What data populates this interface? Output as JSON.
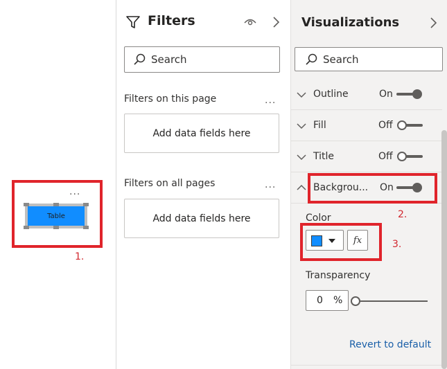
{
  "canvas": {
    "more_label": "...",
    "visual_label": "Table",
    "annotation_1": "1."
  },
  "filters": {
    "title": "Filters",
    "search_placeholder": "Search",
    "page_section": "Filters on this page",
    "page_more": "...",
    "page_drop": "Add data fields here",
    "all_section": "Filters on all pages",
    "all_more": "...",
    "all_drop": "Add data fields here"
  },
  "viz": {
    "title": "Visualizations",
    "search_placeholder": "Search",
    "rows": [
      {
        "label": "Outline",
        "state": "On"
      },
      {
        "label": "Fill",
        "state": "Off"
      },
      {
        "label": "Title",
        "state": "Off"
      },
      {
        "label": "Backgrou...",
        "state": "On"
      }
    ],
    "annotation_2": "2.",
    "color_label": "Color",
    "color_value": "#118dff",
    "fx_label": "fx",
    "annotation_3": "3.",
    "transparency_label": "Transparency",
    "transparency_value": "0",
    "transparency_unit": "%",
    "revert_label": "Revert to default"
  },
  "colors": {
    "accent": "#118dff",
    "annotation": "#e0242b"
  }
}
